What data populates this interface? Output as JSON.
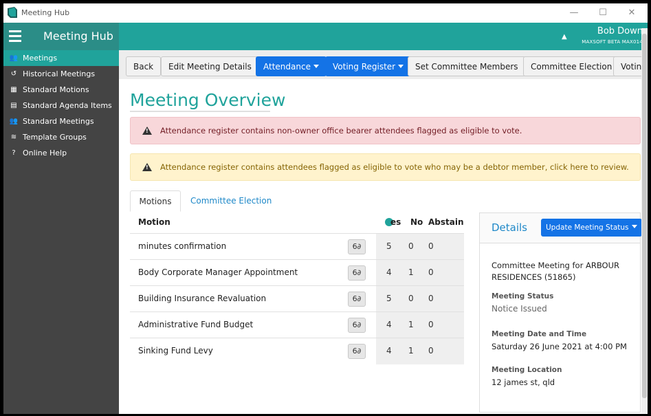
{
  "window": {
    "title": "Meeting Hub",
    "min": "—",
    "max": "☐",
    "close": "✕"
  },
  "header": {
    "brand": "Meeting Hub",
    "user_name": "Bob Down",
    "user_sub": "MAXSOFT BETA MAX014"
  },
  "sidebar": {
    "items": [
      {
        "label": "Meetings",
        "icon": "users-icon",
        "glyph": "👥"
      },
      {
        "label": "Historical Meetings",
        "icon": "history-icon",
        "glyph": "↺"
      },
      {
        "label": "Standard Motions",
        "icon": "chalkboard-icon",
        "glyph": "▦"
      },
      {
        "label": "Standard Agenda Items",
        "icon": "list-icon",
        "glyph": "▤"
      },
      {
        "label": "Standard Meetings",
        "icon": "group-icon",
        "glyph": "👥"
      },
      {
        "label": "Template Groups",
        "icon": "layers-icon",
        "glyph": "≋"
      },
      {
        "label": "Online Help",
        "icon": "question-icon",
        "glyph": "?"
      }
    ]
  },
  "toolbar": {
    "back": "Back",
    "edit": "Edit Meeting Details",
    "attendance": "Attendance",
    "voting_register": "Voting Register",
    "set_committee": "Set Committee Members",
    "committee_election": "Committee Election",
    "voting": "Voting"
  },
  "page": {
    "title": "Meeting Overview"
  },
  "alerts": {
    "danger": "Attendance register contains non-owner office bearer attendees flagged as eligible to vote.",
    "warning": "Attendance register contains attendees flagged as eligible to vote who may be a debtor member, click here to review."
  },
  "tabs": {
    "motions": "Motions",
    "committee_election": "Committee Election"
  },
  "motions": {
    "headers": {
      "motion": "Motion",
      "yes": "es",
      "no": "No",
      "abstain": "Abstain"
    },
    "view_glyph": "6∂",
    "rows": [
      {
        "name": "minutes confirmation",
        "yes": "5",
        "no": "0",
        "abstain": "0"
      },
      {
        "name": "Body Corporate Manager Appointment",
        "yes": "4",
        "no": "1",
        "abstain": "0"
      },
      {
        "name": "Building Insurance Revaluation",
        "yes": "5",
        "no": "0",
        "abstain": "0"
      },
      {
        "name": "Administrative Fund Budget",
        "yes": "4",
        "no": "1",
        "abstain": "0"
      },
      {
        "name": "Sinking Fund Levy",
        "yes": "4",
        "no": "1",
        "abstain": "0"
      }
    ]
  },
  "details": {
    "title": "Details",
    "update_button": "Update Meeting Status",
    "meeting_name": "Committee Meeting for ARBOUR RESIDENCES (51865)",
    "status_label": "Meeting Status",
    "status_value": "Notice Issued",
    "datetime_label": "Meeting Date and Time",
    "datetime_value": "Saturday 26 June 2021 at 4:00 PM",
    "location_label": "Meeting Location",
    "location_value": "12 james st, qld"
  },
  "colors": {
    "teal": "#20a39b",
    "blue": "#1473e6",
    "sidebar": "#444444"
  }
}
